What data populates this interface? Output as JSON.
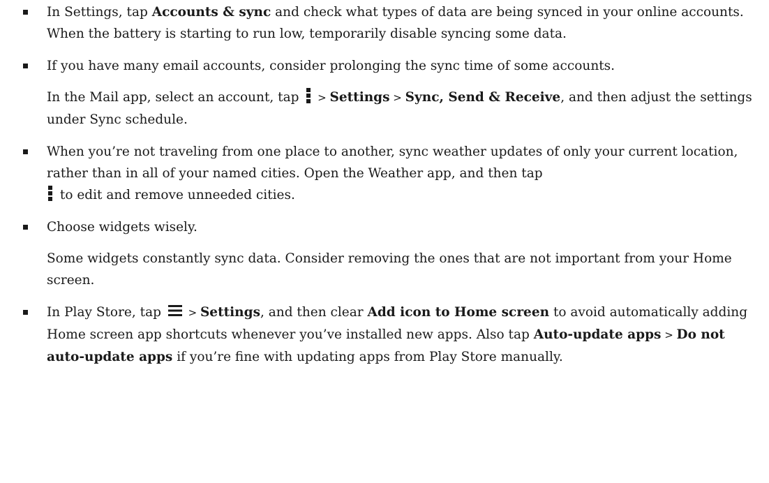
{
  "tips": [
    {
      "p1": {
        "t1": "In Settings, tap ",
        "b1": "Accounts & sync",
        "t2": " and check what types of data are being synced in your online accounts. When the battery is starting to run low, temporarily disable syncing some data."
      }
    },
    {
      "p1": {
        "t1": "If you have many email accounts, consider prolonging the sync time of some accounts."
      },
      "p2": {
        "t1": "In the Mail app, select an account, tap ",
        "gt1": " > ",
        "b1": "Settings",
        "gt2": " > ",
        "b2": "Sync, Send & Receive",
        "t2": ", and then adjust the settings under Sync schedule."
      }
    },
    {
      "p1": {
        "t1": "When you’re not traveling from one place to another, sync weather updates of only your current location, rather than in all of your named cities. Open the Weather app, and then tap",
        "t2": " to edit and remove unneeded cities."
      }
    },
    {
      "p1": {
        "t1": "Choose widgets wisely."
      },
      "p2": {
        "t1": "Some widgets constantly sync data. Consider removing the ones that are not important from your Home screen."
      }
    },
    {
      "p1": {
        "t1": "In Play Store, tap ",
        "gt1": " > ",
        "b1": "Settings",
        "t2": ", and then clear ",
        "b2": "Add icon to Home screen",
        "t3": " to avoid automatically adding Home screen app shortcuts whenever you’ve installed new apps. Also tap ",
        "b3": "Auto-update apps",
        "gt2": " > ",
        "b4": "Do not auto-update apps",
        "t4": " if you’re fine with updating apps from Play Store manually."
      }
    }
  ],
  "icons": {
    "kebab": "more-vertical-icon",
    "hamburger": "menu-icon"
  }
}
